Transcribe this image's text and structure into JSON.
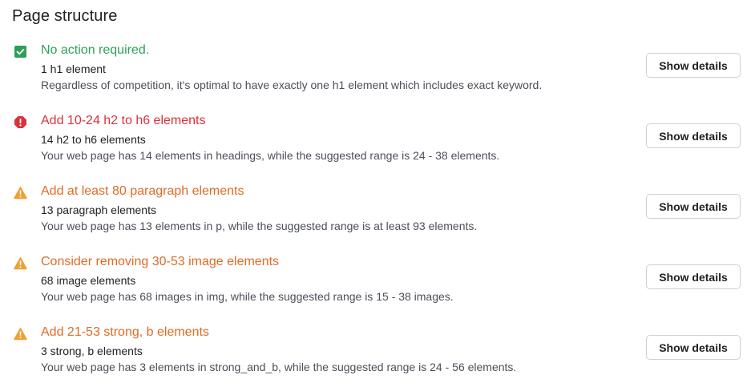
{
  "page": {
    "title": "Page structure"
  },
  "colors": {
    "ok": "#2e9f5a",
    "error": "#d8323a",
    "warn": "#f0a033",
    "warn_text": "#e06b25"
  },
  "items": [
    {
      "status": "ok",
      "icon": "check-square-icon",
      "title": "No action required.",
      "count": "1 h1 element",
      "description": "Regardless of competition, it's optimal to have exactly one h1 element which includes exact keyword.",
      "button_label": "Show details"
    },
    {
      "status": "error",
      "icon": "error-octagon-icon",
      "title": "Add 10-24 h2 to h6 elements",
      "count": "14 h2 to h6 elements",
      "description": "Your web page has 14 elements in headings, while the suggested range is 24 - 38 elements.",
      "button_label": "Show details"
    },
    {
      "status": "warn",
      "icon": "warning-triangle-icon",
      "title": "Add at least 80 paragraph elements",
      "count": "13 paragraph elements",
      "description": "Your web page has 13 elements in p, while the suggested range is at least 93 elements.",
      "button_label": "Show details"
    },
    {
      "status": "warn",
      "icon": "warning-triangle-icon",
      "title": "Consider removing 30-53 image elements",
      "count": "68 image elements",
      "description": "Your web page has 68 images in img, while the suggested range is 15 - 38 images.",
      "button_label": "Show details"
    },
    {
      "status": "warn",
      "icon": "warning-triangle-icon",
      "title": "Add 21-53 strong, b elements",
      "count": "3 strong, b elements",
      "description": "Your web page has 3 elements in strong_and_b, while the suggested range is 24 - 56 elements.",
      "button_label": "Show details"
    }
  ]
}
